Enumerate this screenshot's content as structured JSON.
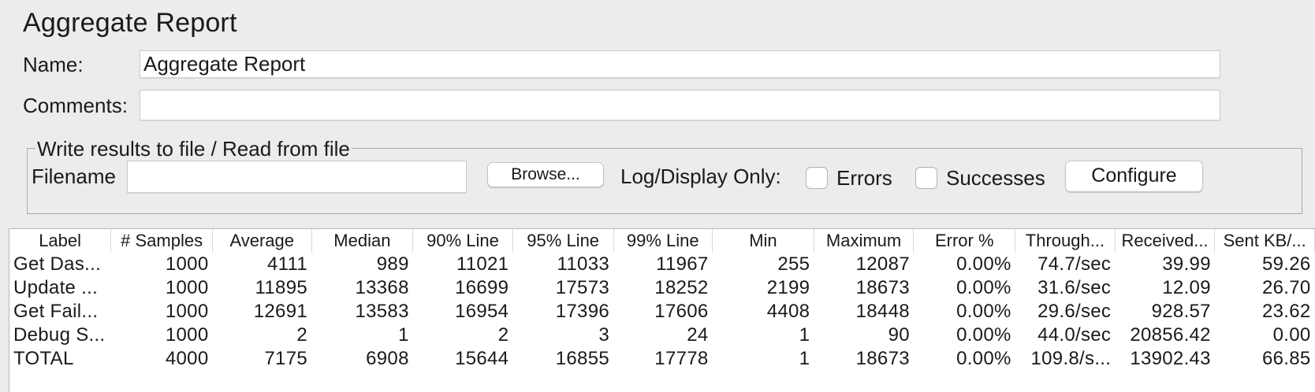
{
  "title": "Aggregate Report",
  "name_field": {
    "label": "Name:",
    "value": "Aggregate Report"
  },
  "comments_field": {
    "label": "Comments:",
    "value": ""
  },
  "file_group": {
    "legend": "Write results to file / Read from file",
    "filename_label": "Filename",
    "filename_value": "",
    "browse_label": "Browse...",
    "log_display_label": "Log/Display Only:",
    "errors_label": "Errors",
    "errors_checked": false,
    "successes_label": "Successes",
    "successes_checked": false,
    "configure_label": "Configure"
  },
  "table": {
    "headers": [
      "Label",
      "# Samples",
      "Average",
      "Median",
      "90% Line",
      "95% Line",
      "99% Line",
      "Min",
      "Maximum",
      "Error %",
      "Through...",
      "Received...",
      "Sent KB/..."
    ],
    "rows": [
      [
        "Get Das...",
        "1000",
        "4111",
        "989",
        "11021",
        "11033",
        "11967",
        "255",
        "12087",
        "0.00%",
        "74.7/sec",
        "39.99",
        "59.26"
      ],
      [
        "Update ...",
        "1000",
        "11895",
        "13368",
        "16699",
        "17573",
        "18252",
        "2199",
        "18673",
        "0.00%",
        "31.6/sec",
        "12.09",
        "26.70"
      ],
      [
        "Get Fail...",
        "1000",
        "12691",
        "13583",
        "16954",
        "17396",
        "17606",
        "4408",
        "18448",
        "0.00%",
        "29.6/sec",
        "928.57",
        "23.62"
      ],
      [
        "Debug S...",
        "1000",
        "2",
        "1",
        "2",
        "3",
        "24",
        "1",
        "90",
        "0.00%",
        "44.0/sec",
        "20856.42",
        "0.00"
      ],
      [
        "TOTAL",
        "4000",
        "7175",
        "6908",
        "15644",
        "16855",
        "17778",
        "1",
        "18673",
        "0.00%",
        "109.8/s...",
        "13902.43",
        "66.85"
      ]
    ]
  }
}
